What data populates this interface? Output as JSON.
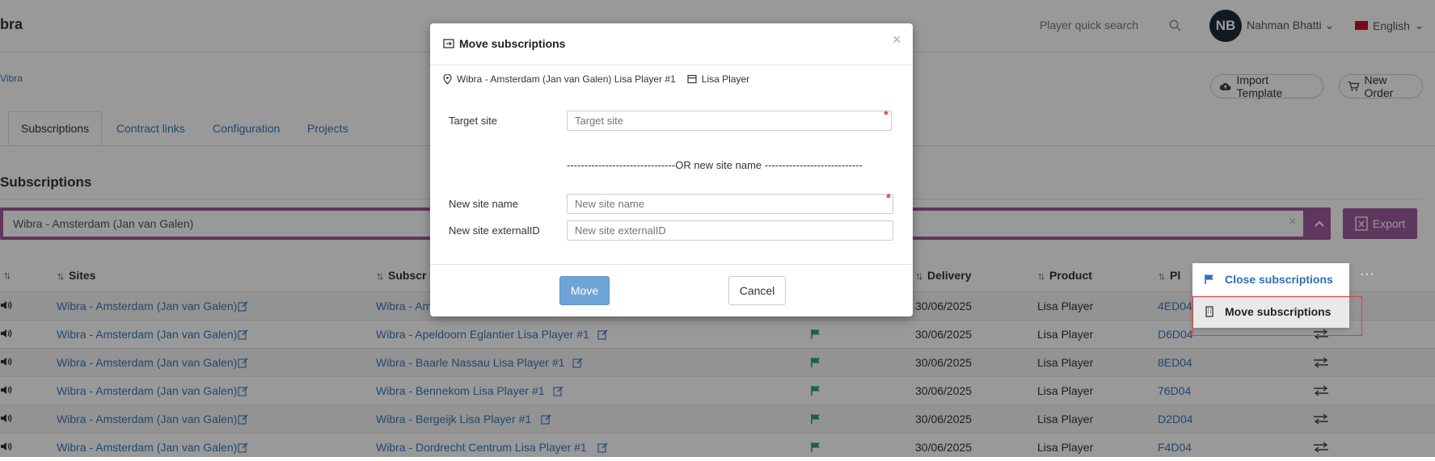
{
  "header": {
    "logo": "bra",
    "quick_search_placeholder": "Player quick search",
    "avatar_initials": "NB",
    "user_name": "Nahman Bhatti",
    "language": "English"
  },
  "breadcrumb": "Vibra",
  "top_buttons": {
    "import_template": "Import Template",
    "new_order": "New Order"
  },
  "tabs": [
    {
      "label": "Subscriptions"
    },
    {
      "label": "Contract links"
    },
    {
      "label": "Configuration"
    },
    {
      "label": "Projects"
    }
  ],
  "section_title": "Subscriptions",
  "filter": {
    "value": "Wibra - Amsterdam (Jan van Galen)",
    "clear": "×",
    "export_label": "Export"
  },
  "table": {
    "columns": {
      "sites": "Sites",
      "subscriptions": "Subscr",
      "delivery": "Delivery",
      "product": "Product",
      "player": "Pl",
      "more": "···"
    },
    "rows": [
      {
        "site": "Wibra - Amsterdam (Jan van Galen)",
        "subscription": "Wibra - Am",
        "delivery": "30/06/2025",
        "product": "Lisa Player",
        "player": "4ED04"
      },
      {
        "site": "Wibra - Amsterdam (Jan van Galen)",
        "subscription": "Wibra - Apeldoorn Eglantier Lisa Player #1",
        "delivery": "30/06/2025",
        "product": "Lisa Player",
        "player": "D6D04"
      },
      {
        "site": "Wibra - Amsterdam (Jan van Galen)",
        "subscription": "Wibra - Baarle Nassau Lisa Player #1",
        "delivery": "30/06/2025",
        "product": "Lisa Player",
        "player": "8ED04"
      },
      {
        "site": "Wibra - Amsterdam (Jan van Galen)",
        "subscription": "Wibra - Bennekom Lisa Player #1",
        "delivery": "30/06/2025",
        "product": "Lisa Player",
        "player": "76D04"
      },
      {
        "site": "Wibra - Amsterdam (Jan van Galen)",
        "subscription": "Wibra - Bergeijk Lisa Player #1",
        "delivery": "30/06/2025",
        "product": "Lisa Player",
        "player": "D2D04"
      },
      {
        "site": "Wibra - Amsterdam (Jan van Galen)",
        "subscription": "Wibra - Dordrecht Centrum Lisa Player #1",
        "delivery": "30/06/2025",
        "product": "Lisa Player",
        "player": "F4D04"
      }
    ]
  },
  "context_menu": {
    "close_subscriptions": "Close subscriptions",
    "move_subscriptions": "Move subscriptions"
  },
  "modal": {
    "title": "Move subscriptions",
    "info_site": "Wibra - Amsterdam (Jan van Galen) Lisa Player #1",
    "info_product": "Lisa Player",
    "target_site_label": "Target site",
    "target_site_placeholder": "Target site",
    "or_text": "-------------------------------OR new site name ----------------------------",
    "new_site_name_label": "New site name",
    "new_site_name_placeholder": "New site name",
    "new_site_external_label": "New site externalID",
    "new_site_external_placeholder": "New site externalID",
    "move_label": "Move",
    "cancel_label": "Cancel",
    "required_mark": "*"
  },
  "colors": {
    "accent": "#9f5b9b",
    "link": "#3b78b3",
    "flag": "#2a9d8f",
    "move_button": "#6fa5d6",
    "highlight_box": "#e53935"
  }
}
